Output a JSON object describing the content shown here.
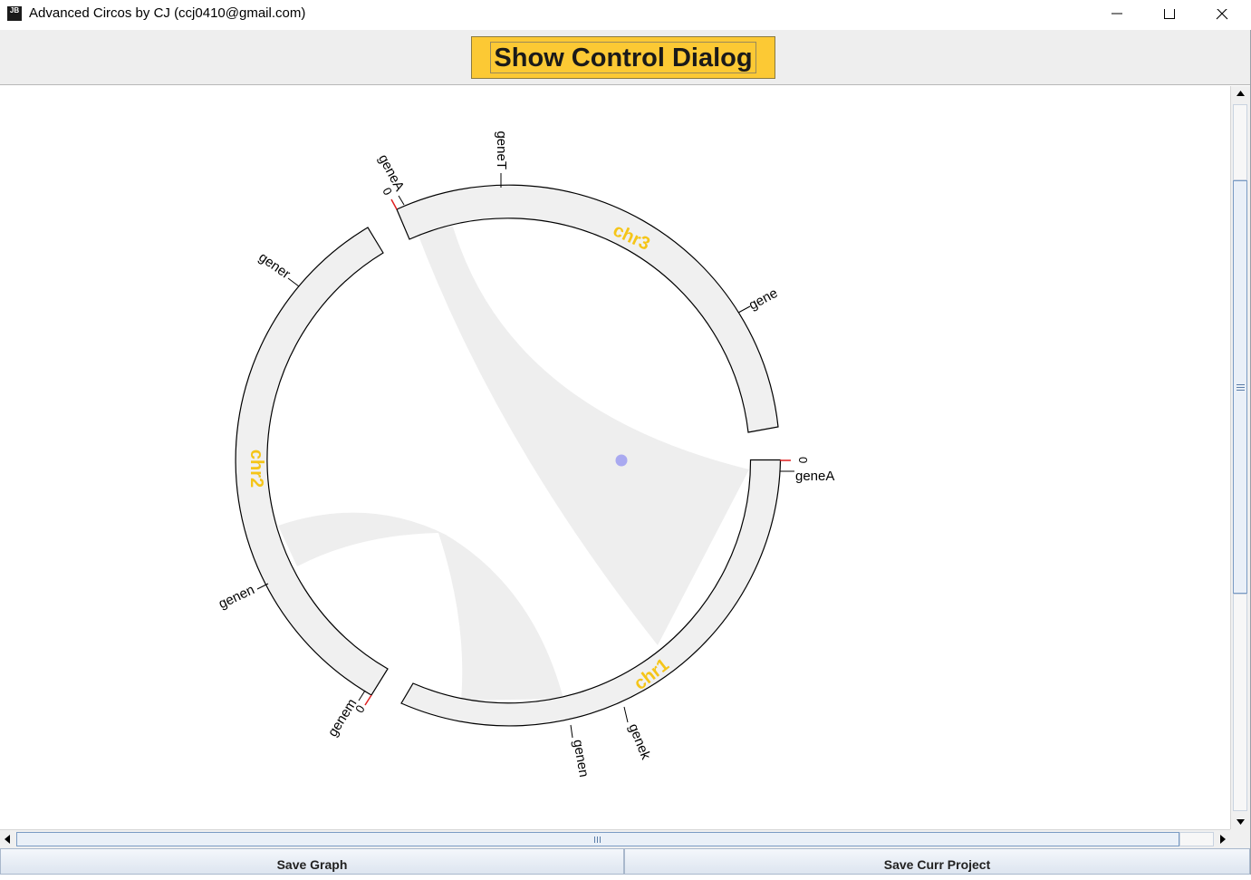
{
  "window": {
    "title": "Advanced Circos by CJ (ccj0410@gmail.com)",
    "icon": "JB",
    "controls": [
      "minimize-icon",
      "maximize-icon",
      "close-icon"
    ]
  },
  "toolbar": {
    "show_dialog_label": "Show Control Dialog",
    "show_dialog_color": "#fcc934"
  },
  "circos": {
    "chromosomes": [
      {
        "name": "chr1",
        "label_color": "#f5c518"
      },
      {
        "name": "chr2",
        "label_color": "#f5c518"
      },
      {
        "name": "chr3",
        "label_color": "#f5c518"
      }
    ],
    "ring_fill": "#f0f0f0",
    "link_fill": "#eeeeee",
    "start_tick_color": "#e02020",
    "center_marker_color": "#a9a9f0",
    "gene_labels": {
      "chr1_start_zero": "0",
      "chr1_start_gene": "geneA",
      "chr1_g1": "genek",
      "chr1_g2": "genen",
      "chr2_start_zero": "0",
      "chr2_start_gene": "genem",
      "chr2_g1": "genen",
      "chr2_g2": "gener",
      "chr3_start_zero": "0",
      "chr3_start_gene": "geneA",
      "chr3_g1": "geneT",
      "chr3_g2": "gene"
    }
  },
  "bottom": {
    "save_graph_label": "Save Graph",
    "save_project_label": "Save Curr Project"
  }
}
